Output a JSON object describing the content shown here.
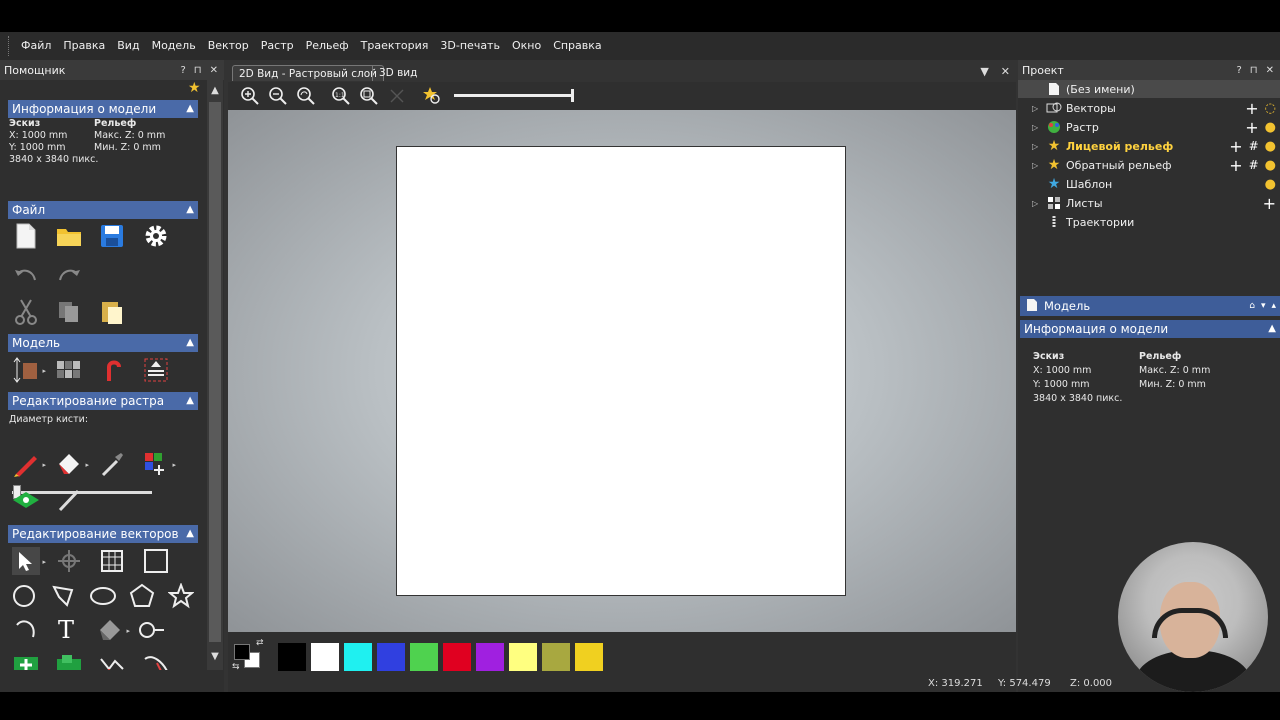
{
  "menu": [
    "Файл",
    "Правка",
    "Вид",
    "Модель",
    "Вектор",
    "Растр",
    "Рельеф",
    "Траектория",
    "3D-печать",
    "Окно",
    "Справка"
  ],
  "assistant": {
    "title": "Помощник",
    "model_info": {
      "header": "Информация о модели",
      "sketch_label": "Эскиз",
      "relief_label": "Рельеф",
      "x": "X: 1000 mm",
      "y": "Y: 1000 mm",
      "maxz": "Макс. Z: 0 mm",
      "minz": "Мин. Z: 0 mm",
      "pixels": "3840 x 3840 пикс."
    },
    "file_header": "Файл",
    "model_header": "Модель",
    "raster_header": "Редактирование растра",
    "brush_label": "Диаметр кисти:",
    "brush_value": 0.02,
    "vector_header": "Редактирование векторов"
  },
  "view": {
    "tab_2d": "2D Вид - Растровый слой",
    "tab_3d": "3D вид",
    "zoom_level": 1.0
  },
  "palette": {
    "primary": "#000000",
    "secondary": "#ffffff",
    "colors": [
      "#000000",
      "#ffffff",
      "#1ff0f0",
      "#3040e0",
      "#4fd24f",
      "#e00020",
      "#a020e0",
      "#ffff80",
      "#a8a840",
      "#f0d020"
    ]
  },
  "project": {
    "title": "Проект",
    "items": [
      {
        "label": "(Без имени)",
        "icon": "document-icon"
      },
      {
        "label": "Векторы",
        "icon": "vectors-icon"
      },
      {
        "label": "Растр",
        "icon": "raster-icon"
      },
      {
        "label": "Лицевой рельеф",
        "icon": "star-icon"
      },
      {
        "label": "Обратный рельеф",
        "icon": "star-icon"
      },
      {
        "label": "Шаблон",
        "icon": "template-star-icon"
      },
      {
        "label": "Листы",
        "icon": "sheets-icon"
      },
      {
        "label": "Траектории",
        "icon": "toolpaths-icon"
      }
    ]
  },
  "model_panel": {
    "title": "Модель",
    "info_header": "Информация о модели",
    "sketch_label": "Эскиз",
    "relief_label": "Рельеф",
    "x": "X: 1000 mm",
    "y": "Y: 1000 mm",
    "maxz": "Макс. Z: 0 mm",
    "minz": "Мин. Z: 0 mm",
    "pixels": "3840 x 3840 пикс."
  },
  "status": {
    "x": "X: 319.271",
    "y": "Y: 574.479",
    "z": "Z: 0.000"
  }
}
